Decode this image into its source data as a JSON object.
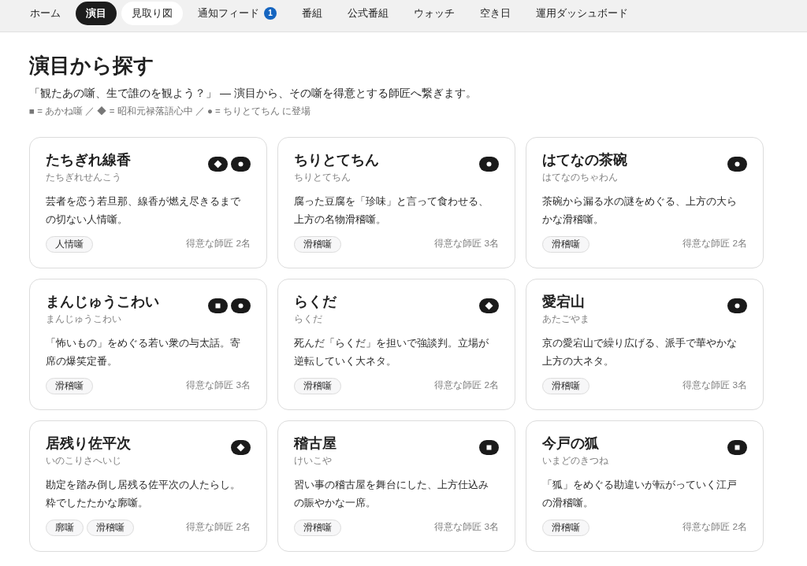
{
  "nav": {
    "items": [
      {
        "label": "ホーム",
        "selected": false,
        "hovered": false
      },
      {
        "label": "演目",
        "selected": true,
        "hovered": false
      },
      {
        "label": "見取り図",
        "selected": false,
        "hovered": true
      },
      {
        "label": "通知フィード",
        "selected": false,
        "hovered": false,
        "badge": "1"
      },
      {
        "label": "番組",
        "selected": false,
        "hovered": false
      },
      {
        "label": "公式番組",
        "selected": false,
        "hovered": false
      },
      {
        "label": "ウォッチ",
        "selected": false,
        "hovered": false
      },
      {
        "label": "空き日",
        "selected": false,
        "hovered": false
      },
      {
        "label": "運用ダッシュボード",
        "selected": false,
        "hovered": false
      }
    ]
  },
  "page": {
    "title": "演目から探す",
    "subtitle": "「観たあの噺、生で誰のを観よう？」 — 演目から、その噺を得意とする師匠へ繋ぎます。",
    "legend": "■ = あかね噺 ／ ◆ = 昭和元禄落語心中 ／ ● = ちりとてちん に登場"
  },
  "cards": [
    {
      "title": "たちぎれ線香",
      "reading": "たちぎれせんこう",
      "marks": [
        {
          "kind": "diamond"
        },
        {
          "kind": "dot"
        }
      ],
      "description": "芸者を恋う若旦那、線香が燃え尽きるまでの切ない人情噺。",
      "tags": [
        "人情噺"
      ],
      "count": "得意な師匠 2名"
    },
    {
      "title": "ちりとてちん",
      "reading": "ちりとてちん",
      "marks": [
        {
          "kind": "dot"
        }
      ],
      "description": "腐った豆腐を「珍味」と言って食わせる、上方の名物滑稽噺。",
      "tags": [
        "滑稽噺"
      ],
      "count": "得意な師匠 3名"
    },
    {
      "title": "はてなの茶碗",
      "reading": "はてなのちゃわん",
      "marks": [
        {
          "kind": "dot"
        }
      ],
      "description": "茶碗から漏る水の謎をめぐる、上方の大らかな滑稽噺。",
      "tags": [
        "滑稽噺"
      ],
      "count": "得意な師匠 2名"
    },
    {
      "title": "まんじゅうこわい",
      "reading": "まんじゅうこわい",
      "marks": [
        {
          "kind": "square"
        },
        {
          "kind": "dot"
        }
      ],
      "description": "「怖いもの」をめぐる若い衆の与太話。寄席の爆笑定番。",
      "tags": [
        "滑稽噺"
      ],
      "count": "得意な師匠 3名"
    },
    {
      "title": "らくだ",
      "reading": "らくだ",
      "marks": [
        {
          "kind": "diamond"
        }
      ],
      "description": "死んだ「らくだ」を担いで強談判。立場が逆転していく大ネタ。",
      "tags": [
        "滑稽噺"
      ],
      "count": "得意な師匠 2名"
    },
    {
      "title": "愛宕山",
      "reading": "あたごやま",
      "marks": [
        {
          "kind": "dot"
        }
      ],
      "description": "京の愛宕山で繰り広げる、派手で華やかな上方の大ネタ。",
      "tags": [
        "滑稽噺"
      ],
      "count": "得意な師匠 3名"
    },
    {
      "title": "居残り佐平次",
      "reading": "いのこりさへいじ",
      "marks": [
        {
          "kind": "diamond"
        }
      ],
      "description": "勘定を踏み倒し居残る佐平次の人たらし。粋でしたたかな廓噺。",
      "tags": [
        "廓噺",
        "滑稽噺"
      ],
      "count": "得意な師匠 2名"
    },
    {
      "title": "稽古屋",
      "reading": "けいこや",
      "marks": [
        {
          "kind": "square"
        }
      ],
      "description": "習い事の稽古屋を舞台にした、上方仕込みの賑やかな一席。",
      "tags": [
        "滑稽噺"
      ],
      "count": "得意な師匠 3名"
    },
    {
      "title": "今戸の狐",
      "reading": "いまどのきつね",
      "marks": [
        {
          "kind": "square"
        }
      ],
      "description": "「狐」をめぐる勘違いが転がっていく江戸の滑稽噺。",
      "tags": [
        "滑稽噺"
      ],
      "count": "得意な師匠 2名"
    }
  ]
}
